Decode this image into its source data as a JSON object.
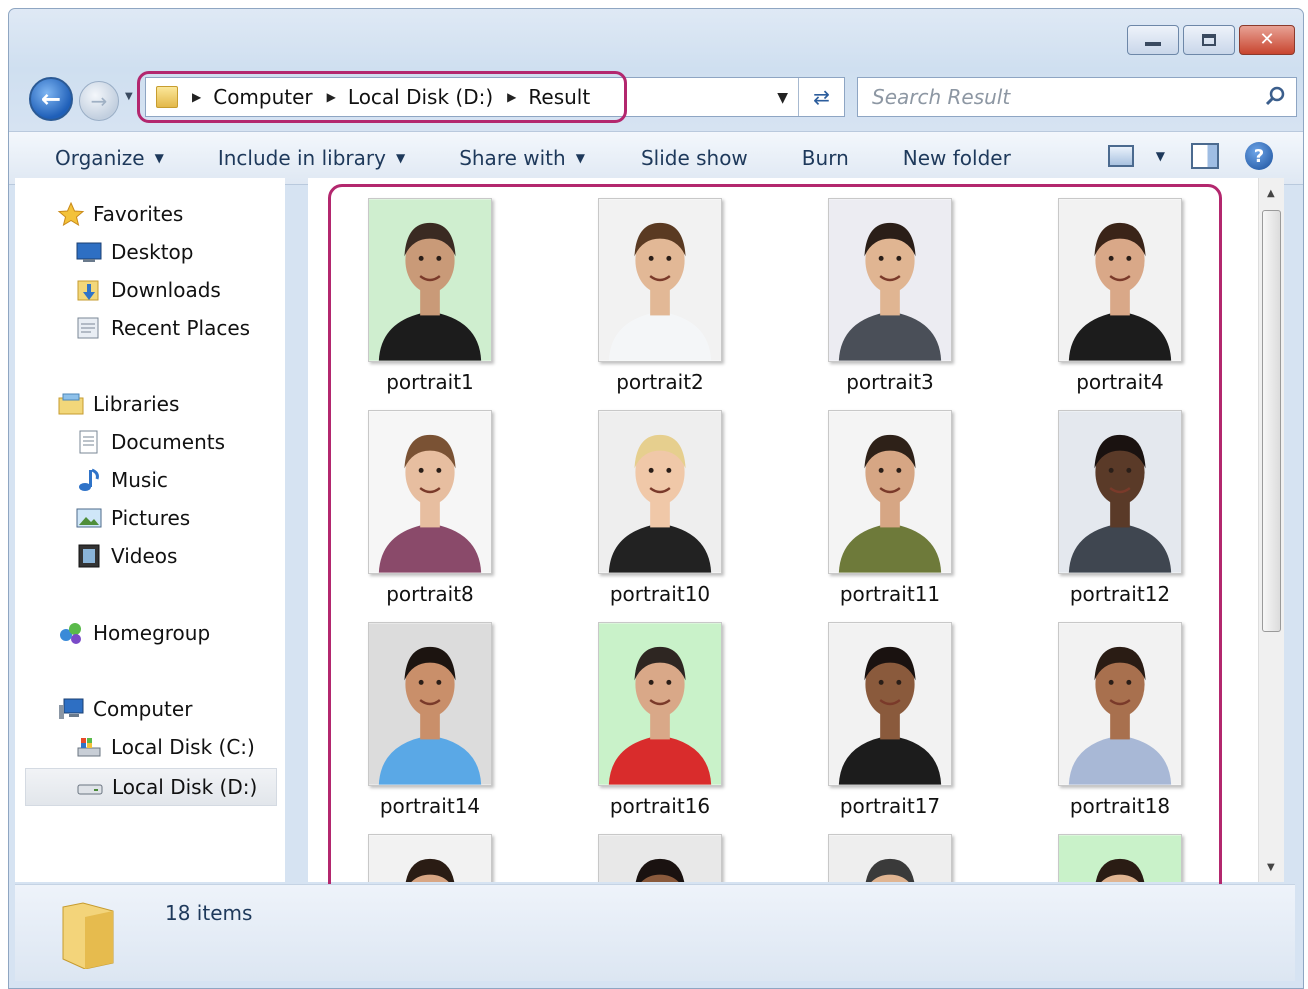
{
  "window": {
    "buttons": [
      "minimize",
      "maximize",
      "close"
    ]
  },
  "address": {
    "crumbs": [
      "Computer",
      "Local Disk (D:)",
      "Result"
    ]
  },
  "search": {
    "placeholder": "Search Result"
  },
  "toolbar": {
    "organize": "Organize",
    "include_in_library": "Include in library",
    "share_with": "Share with",
    "slide_show": "Slide show",
    "burn": "Burn",
    "new_folder": "New folder"
  },
  "navpane": {
    "favorites": "Favorites",
    "desktop": "Desktop",
    "downloads": "Downloads",
    "recent_places": "Recent Places",
    "libraries": "Libraries",
    "documents": "Documents",
    "music": "Music",
    "pictures": "Pictures",
    "videos": "Videos",
    "homegroup": "Homegroup",
    "computer": "Computer",
    "local_disk_c": "Local Disk (C:)",
    "local_disk_d": "Local Disk (D:)"
  },
  "files": [
    {
      "name": "portrait1",
      "bg": "#cfeecf",
      "skin": "#c99a78",
      "hair": "#3a2a22",
      "shirt": "#1c1c1c"
    },
    {
      "name": "portrait2",
      "bg": "#f2f2f2",
      "skin": "#e2b896",
      "hair": "#5a3a22",
      "shirt": "#f4f6f8"
    },
    {
      "name": "portrait3",
      "bg": "#ececf2",
      "skin": "#e0b592",
      "hair": "#2a1e18",
      "shirt": "#4a4f58"
    },
    {
      "name": "portrait4",
      "bg": "#f2f2f2",
      "skin": "#d9a888",
      "hair": "#3a2418",
      "shirt": "#1c1c1c"
    },
    {
      "name": "portrait8",
      "bg": "#f6f6f6",
      "skin": "#e7bea0",
      "hair": "#7a5234",
      "shirt": "#8a4a6a"
    },
    {
      "name": "portrait10",
      "bg": "#eeeeee",
      "skin": "#f0c8a8",
      "hair": "#e6cf8e",
      "shirt": "#222222"
    },
    {
      "name": "portrait11",
      "bg": "#f4f4f4",
      "skin": "#d6a684",
      "hair": "#2e2118",
      "shirt": "#6e7a3a"
    },
    {
      "name": "portrait12",
      "bg": "#e4e8ee",
      "skin": "#5a3a28",
      "hair": "#1a1210",
      "shirt": "#3f4650"
    },
    {
      "name": "portrait14",
      "bg": "#dcdcdc",
      "skin": "#c98f6a",
      "hair": "#1c1410",
      "shirt": "#5aa8e6"
    },
    {
      "name": "portrait16",
      "bg": "#c9f2c9",
      "skin": "#d9a888",
      "hair": "#2e2622",
      "shirt": "#d92c2c"
    },
    {
      "name": "portrait17",
      "bg": "#f2f2f2",
      "skin": "#8a5a3c",
      "hair": "#1a1210",
      "shirt": "#1c1c1c"
    },
    {
      "name": "portrait18",
      "bg": "#f2f2f2",
      "skin": "#a8704e",
      "hair": "#2a1c14",
      "shirt": "#a8b8d6"
    },
    {
      "name": "",
      "bg": "#f2f2f2",
      "skin": "#d8a684",
      "hair": "#2a1c14",
      "shirt": "#444444"
    },
    {
      "name": "",
      "bg": "#e8e8e8",
      "skin": "#8a5a3c",
      "hair": "#1a1210",
      "shirt": "#444444"
    },
    {
      "name": "",
      "bg": "#eeeeee",
      "skin": "#e0b592",
      "hair": "#3a3a3a",
      "shirt": "#444444"
    },
    {
      "name": "",
      "bg": "#c9f2c9",
      "skin": "#e0b592",
      "hair": "#2a1c14",
      "shirt": "#444444"
    }
  ],
  "status": {
    "item_count": "18 items"
  },
  "colors": {
    "highlight": "#b3276e",
    "toolbar_text": "#1e395b"
  }
}
